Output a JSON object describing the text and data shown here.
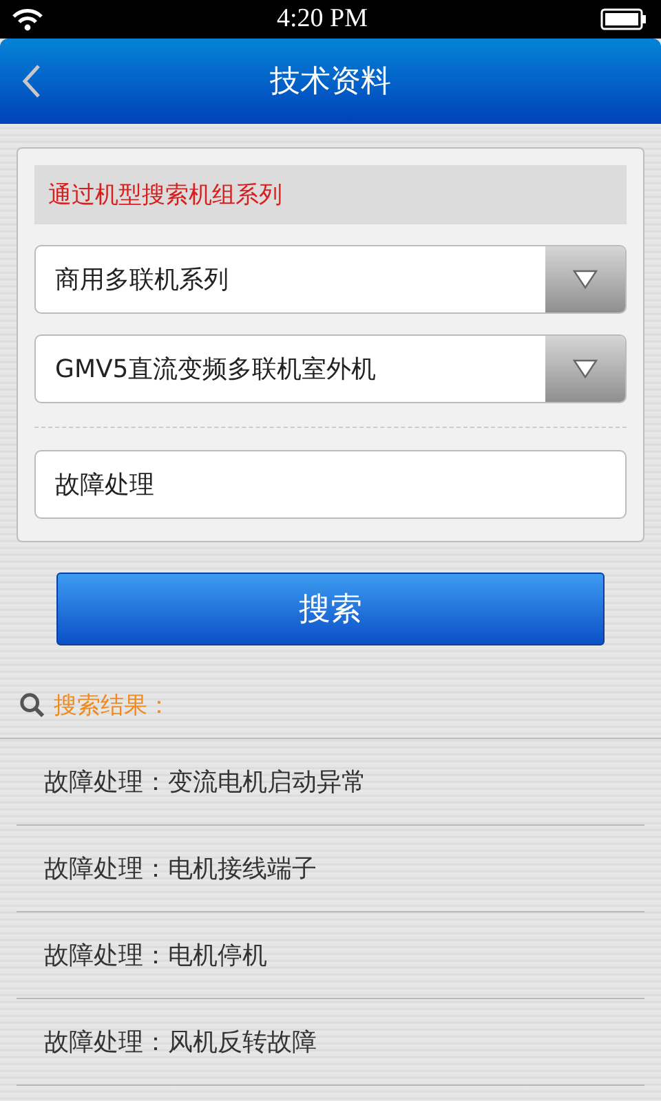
{
  "status_bar": {
    "time": "4:20 PM"
  },
  "header": {
    "title": "技术资料"
  },
  "filter_panel": {
    "heading": "通过机型搜索机组系列",
    "dropdowns": [
      {
        "value": "商用多联机系列"
      },
      {
        "value": "GMV5直流变频多联机室外机"
      }
    ],
    "keyword_field": {
      "value": "故障处理"
    }
  },
  "search_button": {
    "label": "搜索"
  },
  "results": {
    "heading": "搜索结果：",
    "items": [
      {
        "text": "故障处理：变流电机启动异常"
      },
      {
        "text": "故障处理：电机接线端子"
      },
      {
        "text": "故障处理：电机停机"
      },
      {
        "text": "故障处理：风机反转故障"
      }
    ]
  }
}
